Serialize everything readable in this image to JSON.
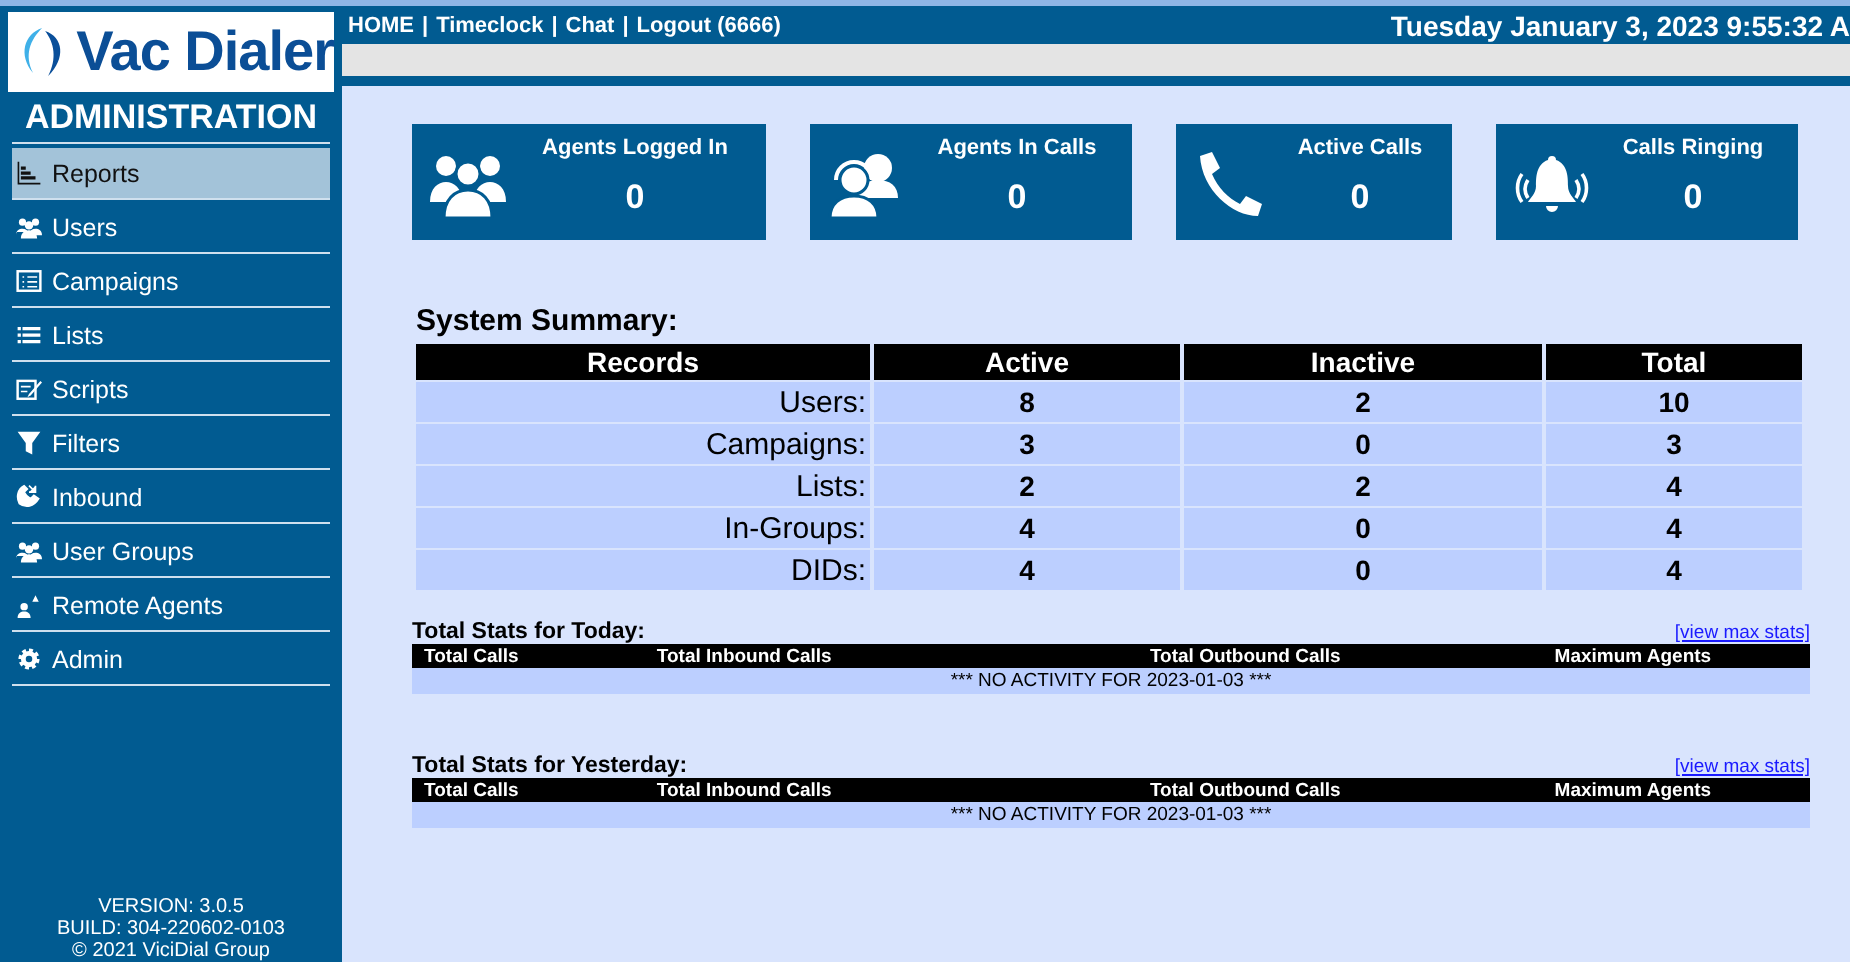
{
  "logo": {
    "text": "Vac Dialer"
  },
  "sidebar": {
    "title": "ADMINISTRATION",
    "items": [
      {
        "label": "Reports",
        "kind": "reports",
        "selected": true
      },
      {
        "label": "Users",
        "kind": "users",
        "selected": false
      },
      {
        "label": "Campaigns",
        "kind": "campaigns",
        "selected": false
      },
      {
        "label": "Lists",
        "kind": "lists",
        "selected": false
      },
      {
        "label": "Scripts",
        "kind": "scripts",
        "selected": false
      },
      {
        "label": "Filters",
        "kind": "filters",
        "selected": false
      },
      {
        "label": "Inbound",
        "kind": "inbound",
        "selected": false
      },
      {
        "label": "User Groups",
        "kind": "users",
        "selected": false
      },
      {
        "label": "Remote Agents",
        "kind": "remote",
        "selected": false
      },
      {
        "label": "Admin",
        "kind": "admin",
        "selected": false
      }
    ],
    "footer": [
      "VERSION: 3.0.5",
      "BUILD: 304-220602-0103",
      "© 2021 ViciDial Group"
    ]
  },
  "top_nav": {
    "separator": "|",
    "links": [
      "HOME",
      "Timeclock",
      "Chat",
      "Logout (6666)"
    ],
    "datetime": "Tuesday January 3, 2023 9:55:32 A"
  },
  "stat_cards": [
    {
      "kind": "agents",
      "label": "Agents Logged In",
      "value": "0"
    },
    {
      "kind": "headset",
      "label": "Agents In Calls",
      "value": "0"
    },
    {
      "kind": "phone",
      "label": "Active Calls",
      "value": "0"
    },
    {
      "kind": "bell",
      "label": "Calls Ringing",
      "value": "0"
    }
  ],
  "system_summary": {
    "title": "System Summary:",
    "columns": [
      "Records",
      "Active",
      "Inactive",
      "Total"
    ],
    "rows": [
      [
        "Users:",
        "8",
        "2",
        "10"
      ],
      [
        "Campaigns:",
        "3",
        "0",
        "3"
      ],
      [
        "Lists:",
        "2",
        "2",
        "4"
      ],
      [
        "In-Groups:",
        "4",
        "0",
        "4"
      ],
      [
        "DIDs:",
        "4",
        "0",
        "4"
      ]
    ]
  },
  "daily_stats": [
    {
      "title": "Total Stats for Today:",
      "link": "[view max stats]",
      "columns": [
        "Total Calls",
        "Total Inbound Calls",
        "Total Outbound Calls",
        "Maximum Agents"
      ],
      "message": "*** NO ACTIVITY FOR 2023-01-03 ***"
    },
    {
      "title": "Total Stats for Yesterday:",
      "link": "[view max stats]",
      "columns": [
        "Total Calls",
        "Total Inbound Calls",
        "Total Outbound Calls",
        "Maximum Agents"
      ],
      "message": "*** NO ACTIVITY FOR 2023-01-03 ***"
    }
  ]
}
